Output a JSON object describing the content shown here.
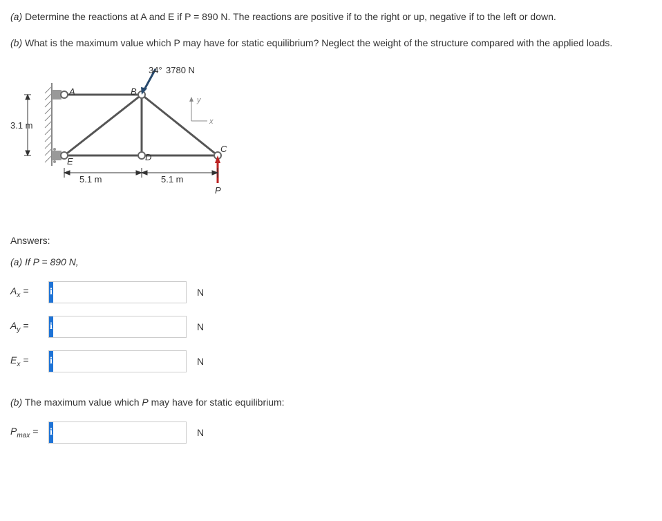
{
  "questions": {
    "a_label": "(a)",
    "a_text": " Determine the reactions at A and E if P = 890 N. The reactions are positive if to the right or up, negative if to the left or down.",
    "b_label": "(b)",
    "b_text": " What is the maximum value which P may have for static equilibrium? Neglect the weight of the structure compared with the applied loads."
  },
  "diagram": {
    "angle": "34°",
    "force": "3780 N",
    "dim_vert": "3.1 m",
    "dim_h1": "5.1 m",
    "dim_h2": "5.1 m",
    "pt_A": "A",
    "pt_B": "B",
    "pt_C": "C",
    "pt_D": "D",
    "pt_E": "E",
    "pt_P": "P",
    "axis_x": "x",
    "axis_y": "y"
  },
  "answers": {
    "header": "Answers:",
    "part_a_label": "(a) If P = 890 N,",
    "rows": [
      {
        "label_var": "A",
        "label_sub": "x",
        "unit": "N"
      },
      {
        "label_var": "A",
        "label_sub": "y",
        "unit": "N"
      },
      {
        "label_var": "E",
        "label_sub": "x",
        "unit": "N"
      }
    ],
    "part_b_text": "(b) The maximum value which P may have for static equilibrium:",
    "pmax_var": "P",
    "pmax_sub": "max",
    "pmax_unit": "N",
    "info_icon": "i"
  }
}
